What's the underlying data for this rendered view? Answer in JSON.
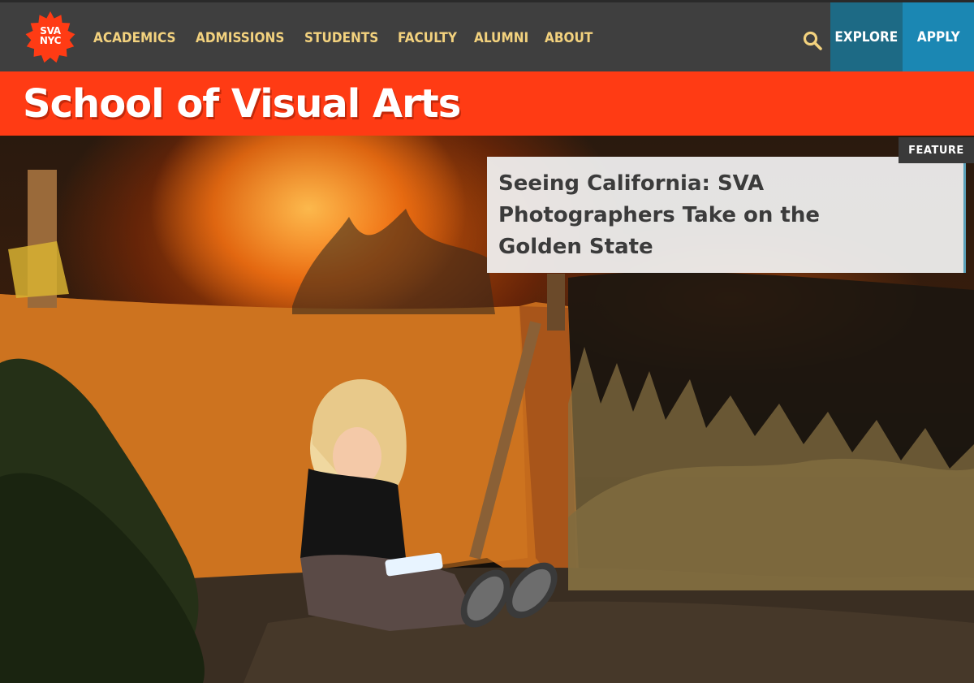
{
  "header": {
    "logo": {
      "line1": "SVA",
      "line2": "NYC",
      "color": "#ff3b14"
    },
    "nav": [
      {
        "label": "ACADEMICS"
      },
      {
        "label": "ADMISSIONS"
      },
      {
        "label": "STUDENTS"
      },
      {
        "label": "FACULTY"
      },
      {
        "label": "ALUMNI"
      },
      {
        "label": "ABOUT"
      }
    ],
    "search_icon": "search-icon",
    "explore_label": "EXPLORE",
    "apply_label": "APPLY",
    "colors": {
      "bar": "#3f3f3f",
      "nav_text": "#f3d27e",
      "explore": "#1d6a85",
      "apply": "#1b87b3"
    }
  },
  "band": {
    "title": "School of Visual Arts",
    "color": "#ff3b14"
  },
  "hero": {
    "feature_title": "Seeing California: SVA Photographers Take on the Golden State",
    "feature_tag": "FEATURE"
  }
}
